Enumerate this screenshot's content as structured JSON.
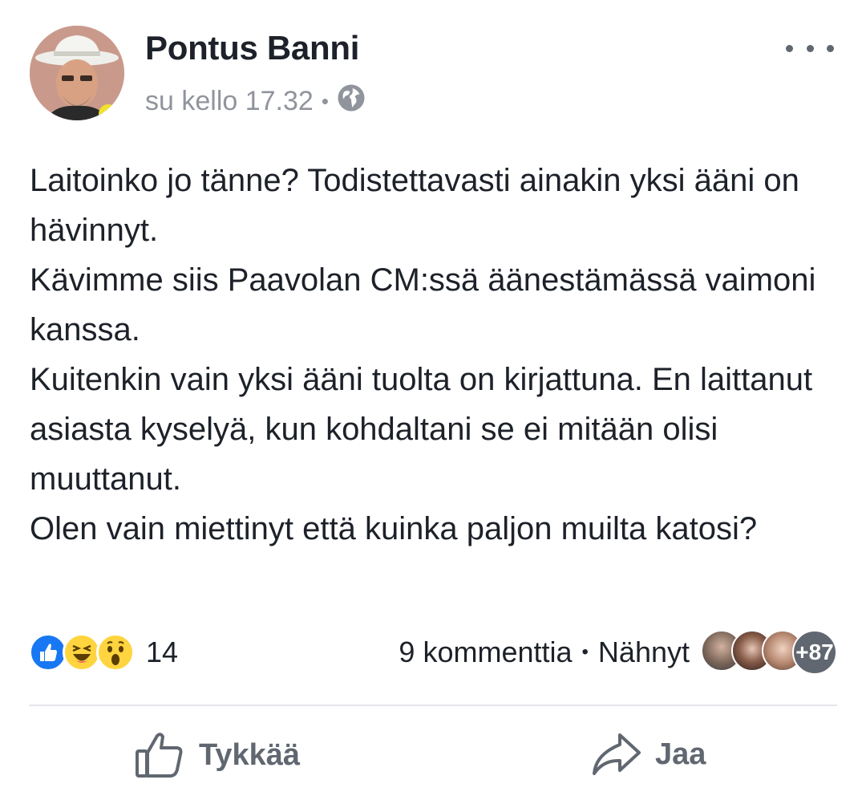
{
  "post": {
    "author": "Pontus Banni",
    "timestamp": "su kello 17.32",
    "separator": "•",
    "privacy_icon": "globe-icon",
    "more_icon": "more-options-icon",
    "paragraphs": [
      "Laitoinko jo tänne? Todistettavasti ainakin yksi ääni on hävinnyt.",
      "Kävimme siis Paavolan CM:ssä äänestämässä vaimoni kanssa.",
      "Kuitenkin vain yksi ääni tuolta on kirjattuna. En laittanut asiasta kyselyä, kun kohdaltani se ei mitään olisi muuttanut.",
      "Olen vain miettinyt että kuinka paljon muilta katosi?"
    ]
  },
  "reactions": {
    "icons": [
      "like-reaction-icon",
      "haha-reaction-icon",
      "wow-reaction-icon"
    ],
    "count": "14"
  },
  "stats": {
    "comments": "9 kommenttia",
    "separator": "•",
    "seen_label": "Nähnyt",
    "seen_more": "+87"
  },
  "actions": {
    "like": "Tykkää",
    "share": "Jaa"
  },
  "colors": {
    "brand_blue": "#1877f2",
    "text": "#1d2129",
    "secondary": "#90949c",
    "action_grey": "#606770"
  }
}
